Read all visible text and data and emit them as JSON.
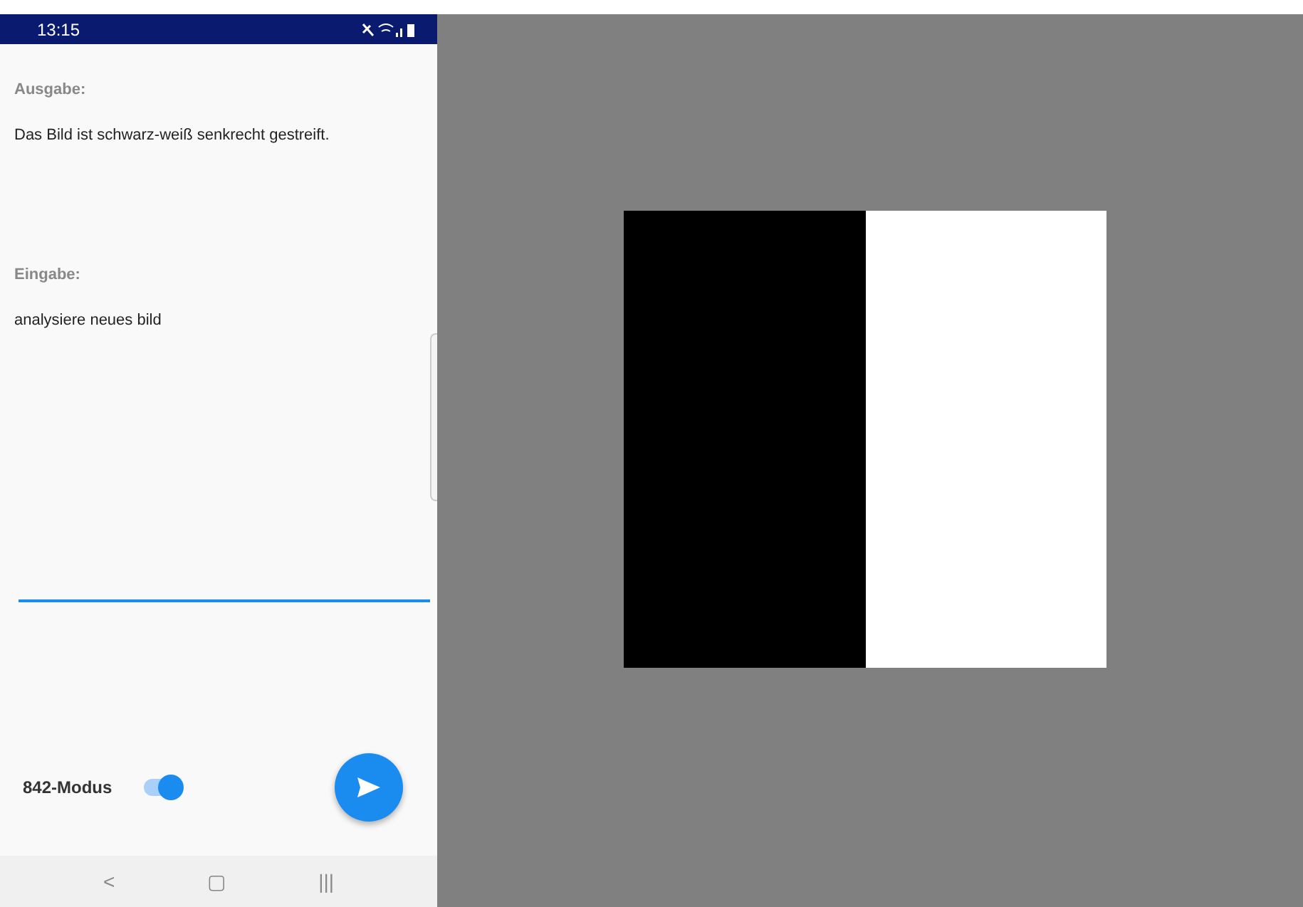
{
  "status_bar": {
    "time": "13:15"
  },
  "output": {
    "label": "Ausgabe:",
    "text": "Das Bild ist schwarz-weiß senkrecht gestreift."
  },
  "input": {
    "label": "Eingabe:",
    "text": "analysiere neues bild"
  },
  "mode_toggle": {
    "label": "842-Modus",
    "on": true
  },
  "nav_bar": {
    "back": "<",
    "home": "▢",
    "recents": "|||"
  }
}
